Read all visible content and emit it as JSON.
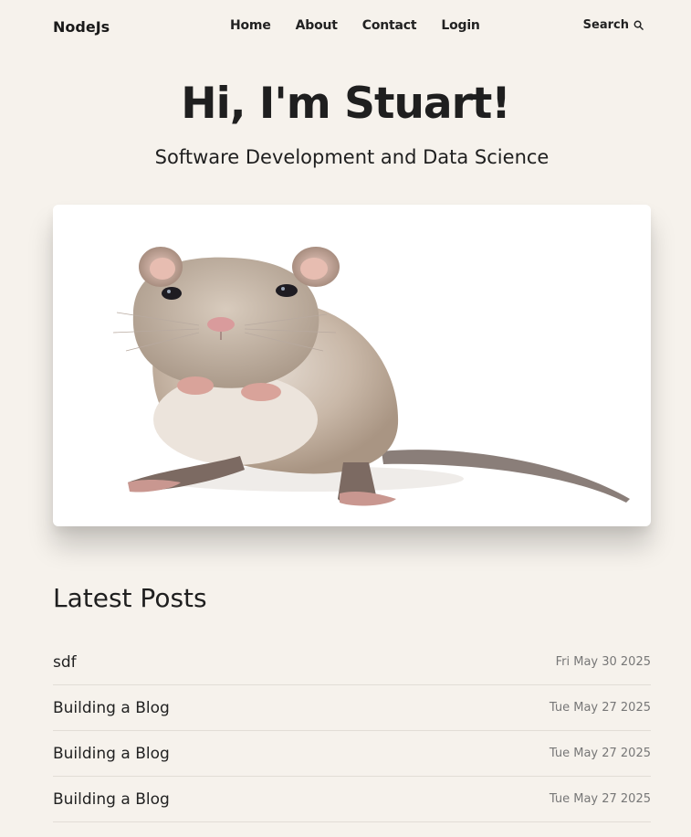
{
  "header": {
    "logo": "NodeJs",
    "nav": [
      "Home",
      "About",
      "Contact",
      "Login"
    ],
    "search_label": "Search"
  },
  "hero": {
    "title": "Hi, I'm Stuart!",
    "subtitle": "Software Development and Data Science",
    "image_subject": "mouse"
  },
  "latest": {
    "heading": "Latest Posts",
    "posts": [
      {
        "title": "sdf",
        "date": "Fri May 30 2025"
      },
      {
        "title": "Building a Blog",
        "date": "Tue May 27 2025"
      },
      {
        "title": "Building a Blog",
        "date": "Tue May 27 2025"
      },
      {
        "title": "Building a Blog",
        "date": "Tue May 27 2025"
      }
    ]
  }
}
